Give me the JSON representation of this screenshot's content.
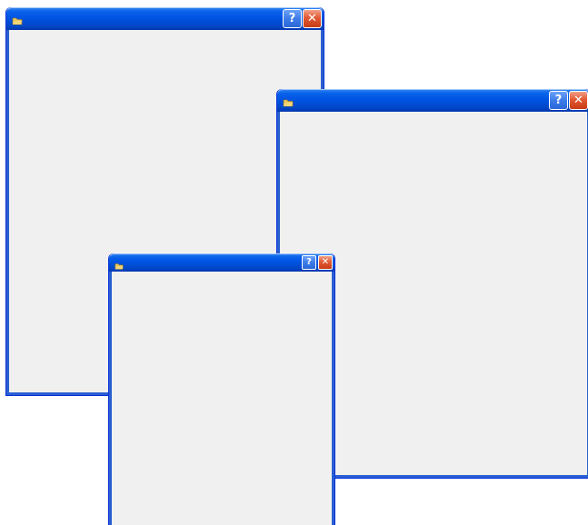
{
  "windows": [
    {
      "id": "dialog-1",
      "title": "",
      "app_icon": "window-app-icon",
      "buttons": [
        {
          "name": "help-button",
          "glyph": "?"
        },
        {
          "name": "close-button",
          "glyph": "✕"
        }
      ]
    },
    {
      "id": "dialog-2",
      "title": "",
      "app_icon": "window-app-icon",
      "buttons": [
        {
          "name": "help-button",
          "glyph": "?"
        },
        {
          "name": "close-button",
          "glyph": "✕"
        }
      ]
    },
    {
      "id": "dialog-3",
      "title": "",
      "app_icon": "window-app-icon",
      "buttons": [
        {
          "name": "help-button",
          "glyph": "?"
        },
        {
          "name": "close-button",
          "glyph": "✕"
        }
      ]
    }
  ],
  "colors": {
    "titlebar": "#0054e3",
    "frame": "#2a5fd1",
    "client": "#f0f0f0",
    "help_button": "#3d7ce8",
    "close_button": "#e25a34",
    "desktop": "#ffffff"
  }
}
